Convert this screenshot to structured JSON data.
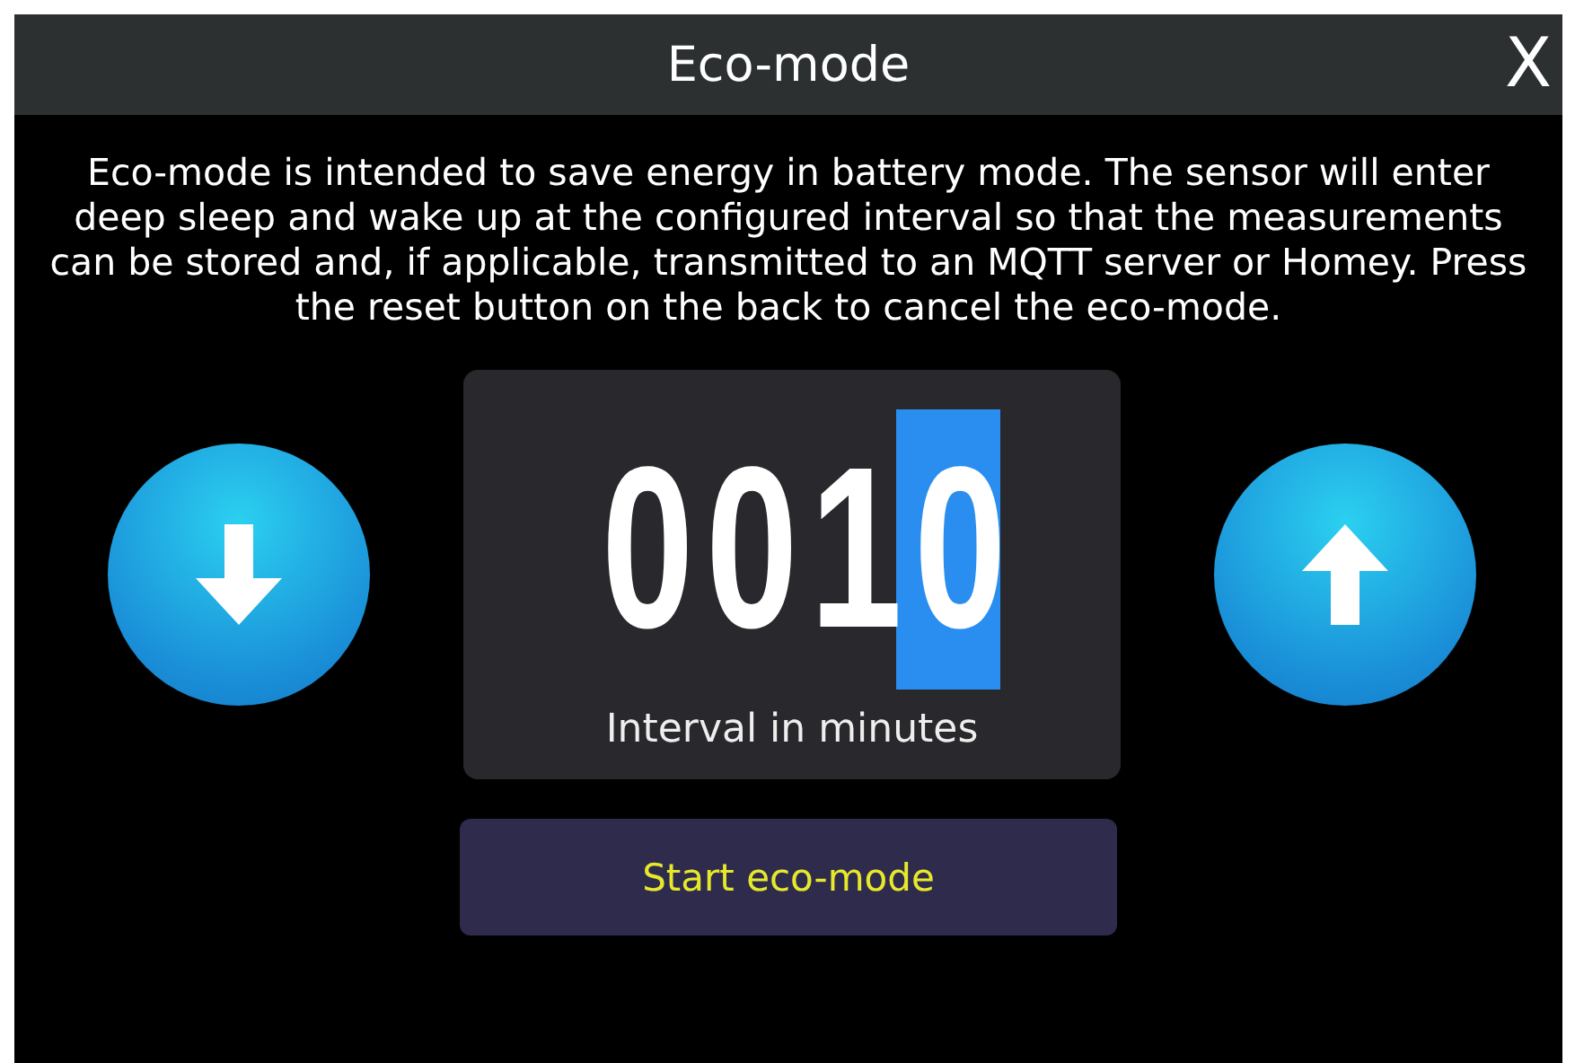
{
  "window": {
    "title": "Eco-mode",
    "close": "X"
  },
  "description": "Eco-mode is intended to save energy in battery mode. The sensor will enter deep sleep and wake up at the configured interval so that the measurements can be stored and, if applicable, transmitted to an MQTT server or Homey. Press the reset button on the back to cancel the eco-mode.",
  "interval": {
    "digits": [
      {
        "value": "0",
        "selected": false
      },
      {
        "value": "0",
        "selected": false
      },
      {
        "value": "1",
        "selected": false
      },
      {
        "value": "0",
        "selected": true
      }
    ],
    "label": "Interval in minutes"
  },
  "start_button": "Start eco-mode"
}
